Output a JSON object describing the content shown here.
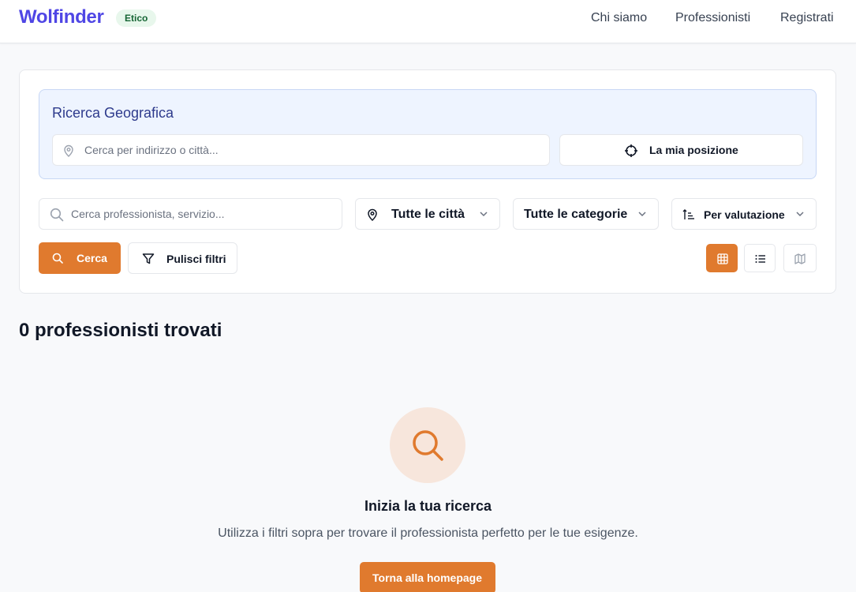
{
  "header": {
    "brand": "Wolfinder",
    "badge": "Etico",
    "nav": [
      "Chi siamo",
      "Professionisti",
      "Registrati"
    ]
  },
  "geo_search": {
    "title": "Ricerca Geografica",
    "address_placeholder": "Cerca per indirizzo o città...",
    "location_button": "La mia posizione"
  },
  "filters": {
    "search_placeholder": "Cerca professionista, servizio...",
    "city_select": "Tutte le città",
    "category_select": "Tutte le categorie",
    "sort_select": "Per valutazione",
    "search_button": "Cerca",
    "clear_button": "Pulisci filtri",
    "view_modes": [
      {
        "icon": "grid-icon",
        "active": true
      },
      {
        "icon": "list-icon",
        "active": false
      },
      {
        "icon": "map-icon",
        "active": false
      }
    ]
  },
  "results": {
    "count_text": "0 professionisti trovati"
  },
  "empty_state": {
    "icon": "search-icon",
    "title": "Inizia la tua ricerca",
    "description": "Utilizza i filtri sopra per trovare il professionista perfetto per le tue esigenze.",
    "button": "Torna alla homepage"
  },
  "colors": {
    "brand": "#4f46e5",
    "accent": "#e07a2e",
    "geo_bg": "#eef4ff"
  }
}
